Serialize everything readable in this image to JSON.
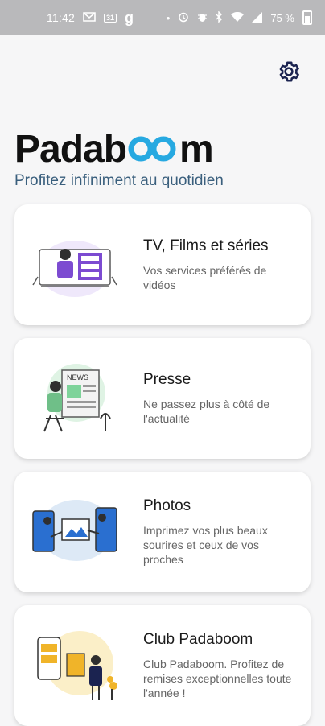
{
  "status_bar": {
    "time": "11:42",
    "left_icons": [
      "gmail-icon",
      "calendar-icon",
      "g-icon"
    ],
    "calendar_day": "31",
    "right_icons": [
      "dot-icon",
      "alarm-icon",
      "bug-icon",
      "bluetooth-icon",
      "wifi-icon",
      "signal-icon"
    ],
    "battery": "75 %"
  },
  "header": {
    "settings_icon": "gear-icon",
    "logo_left": "Padab",
    "logo_right": "m",
    "tagline": "Profitez infiniment au quotidien"
  },
  "cards": [
    {
      "title": "TV, Films et séries",
      "description": "Vos services préférés de vidéos",
      "illustration": "video-illustration"
    },
    {
      "title": "Presse",
      "description": "Ne passez plus à côté de l'actualité",
      "illustration": "newspaper-illustration"
    },
    {
      "title": "Photos",
      "description": "Imprimez vos plus beaux sourires et ceux de vos proches",
      "illustration": "photos-illustration"
    },
    {
      "title": "Club Padaboom",
      "description": "Club Padaboom. Profitez de remises exceptionnelles toute l'année !",
      "illustration": "shopping-illustration"
    }
  ],
  "colors": {
    "status_bar": "#b9b9bb",
    "tagline": "#3a5f7d",
    "logo_oo": "#27a9e1",
    "gear": "#1b2350"
  }
}
